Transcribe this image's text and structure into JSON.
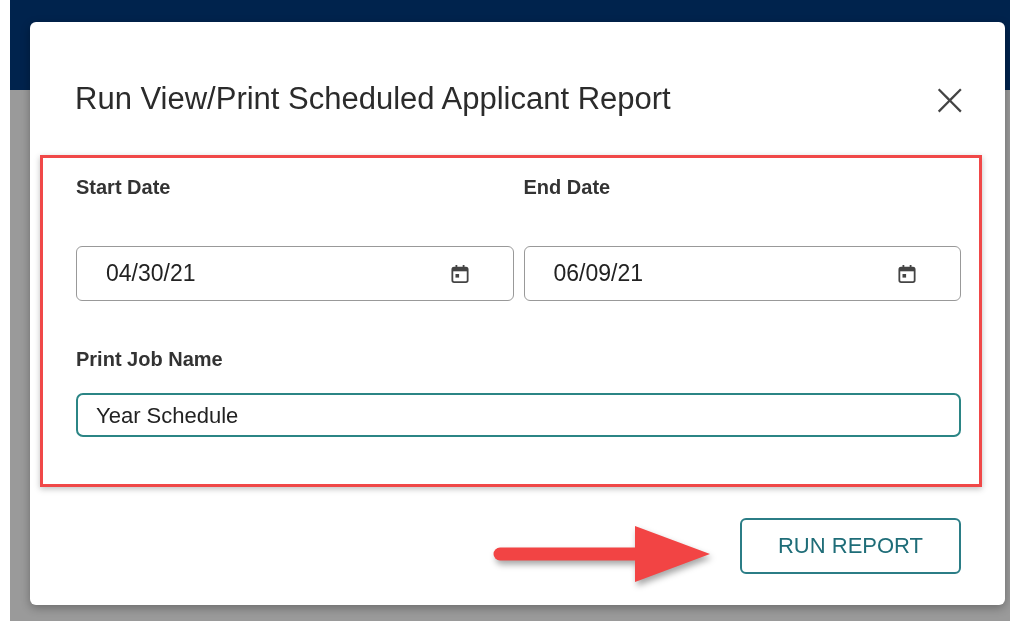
{
  "dialog": {
    "title": "Run View/Print Scheduled Applicant Report",
    "close_icon": "×",
    "start_date": {
      "label": "Start Date",
      "value": "04/30/21"
    },
    "end_date": {
      "label": "End Date",
      "value": "06/09/21"
    },
    "print_job_name": {
      "label": "Print Job Name",
      "value": "Year Schedule",
      "focused": true
    },
    "buttons": [
      {
        "label": "RUN REPORT",
        "kind": "outlined"
      }
    ]
  }
}
